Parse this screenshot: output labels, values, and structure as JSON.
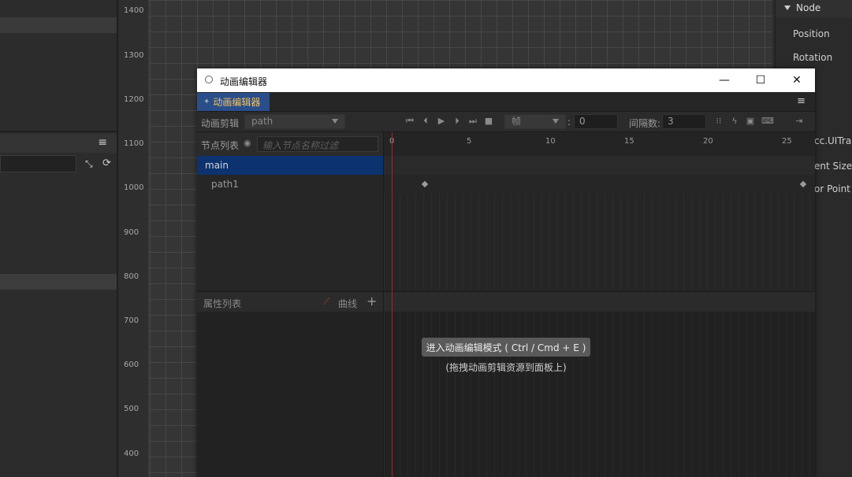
{
  "scene": {
    "ruler_ticks": [
      "1400",
      "1300",
      "1200",
      "1100",
      "1000",
      "900",
      "800",
      "700",
      "600",
      "500",
      "400"
    ]
  },
  "inspector": {
    "section": "Node",
    "rows": [
      "Position",
      "Rotation",
      "cc.UITran",
      "ent Size",
      "or Point"
    ]
  },
  "window": {
    "title": "动画编辑器",
    "minimize": "—",
    "maximize": "☐",
    "close": "✕",
    "tab_label": "动画编辑器",
    "menu_icon": "≡"
  },
  "toolbar": {
    "clip_label": "动画剪辑",
    "clip_value": "path",
    "unit_select": "帧",
    "frame_value": "0",
    "interval_label": "间隔数:",
    "interval_value": "3"
  },
  "nodes": {
    "header": "节点列表",
    "filter_placeholder": "输入节点名称过滤",
    "items": [
      "main",
      "path1"
    ]
  },
  "timeline": {
    "ticks": [
      "0",
      "5",
      "10",
      "15",
      "20",
      "25"
    ]
  },
  "properties": {
    "header": "属性列表",
    "curve_label": "曲线",
    "add_icon": "+"
  },
  "empty_state": {
    "enter_button": "进入动画编辑模式 ( Ctrl / Cmd + E )",
    "hint": "(拖拽动画剪辑资源到面板上)"
  },
  "colors": {
    "tab_active_bg": "#2a4e8a",
    "tab_active_text": "#f0c060",
    "node_selected_bg": "#0c3270",
    "playhead": "#9c2a2a"
  }
}
